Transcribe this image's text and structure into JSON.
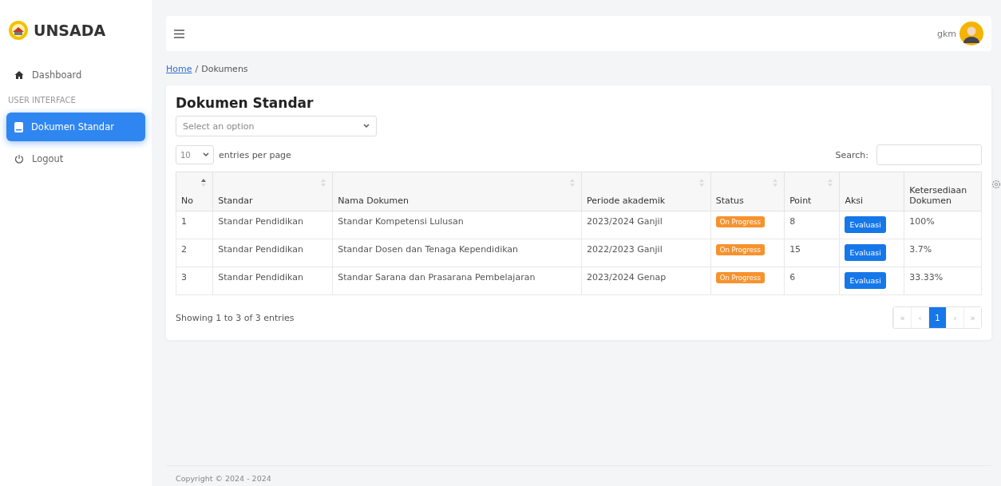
{
  "sidebar": {
    "brand": "UNSADA",
    "items": [
      {
        "kind": "home",
        "label": "Dashboard",
        "selected": false
      },
      {
        "kind": "heading",
        "label": "USER INTERFACE"
      },
      {
        "kind": "document",
        "label": "Dokumen Standar",
        "selected": true
      },
      {
        "kind": "logout",
        "label": "Logout",
        "selected": false
      }
    ]
  },
  "topbar": {
    "user": "gkm"
  },
  "breadcrumb": [
    {
      "kind": "link",
      "label": "Home"
    },
    {
      "kind": "separator",
      "label": "/"
    },
    {
      "kind": "text",
      "label": "Dokumens"
    }
  ],
  "card": {
    "title": "Dokumen Standar",
    "filter": {
      "placeholder": "Select an option"
    },
    "page_size": "10",
    "page_size_label": "entries per page",
    "search_label": "Search:",
    "table": {
      "columns": [
        {
          "kind": "sortable",
          "label": "No",
          "sorted": true
        },
        {
          "kind": "sortable",
          "label": "Standar",
          "sorted": false
        },
        {
          "kind": "sortable",
          "label": "Nama Dokumen",
          "sorted": false
        },
        {
          "kind": "sortable",
          "label": "Periode akademik",
          "sorted": false
        },
        {
          "kind": "sortable",
          "label": "Status",
          "sorted": false
        },
        {
          "kind": "sortable",
          "label": "Point",
          "sorted": false
        },
        {
          "kind": "plain",
          "label": "Aksi"
        },
        {
          "kind": "plain",
          "label": "Ketersediaan Dokumen"
        }
      ],
      "rows": [
        {
          "no": "1",
          "standar": "Standar Pendidikan",
          "nama": "Standar Kompetensi Lulusan",
          "periode": "2023/2024 Ganjil",
          "status": "On Progress",
          "point": "8",
          "aksi": "Evaluasi",
          "ketersediaan": "100%"
        },
        {
          "no": "2",
          "standar": "Standar Pendidikan",
          "nama": "Standar Dosen dan Tenaga Kependidikan",
          "periode": "2022/2023 Ganjil",
          "status": "On Progress",
          "point": "15",
          "aksi": "Evaluasi",
          "ketersediaan": "3.7%"
        },
        {
          "no": "3",
          "standar": "Standar Pendidikan",
          "nama": "Standar Sarana dan Prasarana Pembelajaran",
          "periode": "2023/2024 Genap",
          "status": "On Progress",
          "point": "6",
          "aksi": "Evaluasi",
          "ketersediaan": "33.33%"
        }
      ]
    },
    "info": "Showing 1 to 3 of 3 entries",
    "pagination": [
      {
        "label": "«",
        "selected": false
      },
      {
        "label": "‹",
        "selected": false
      },
      {
        "label": "1",
        "selected": true
      },
      {
        "label": "›",
        "selected": false
      },
      {
        "label": "»",
        "selected": false
      }
    ]
  },
  "footer": "Copyright © 2024 - 2024"
}
